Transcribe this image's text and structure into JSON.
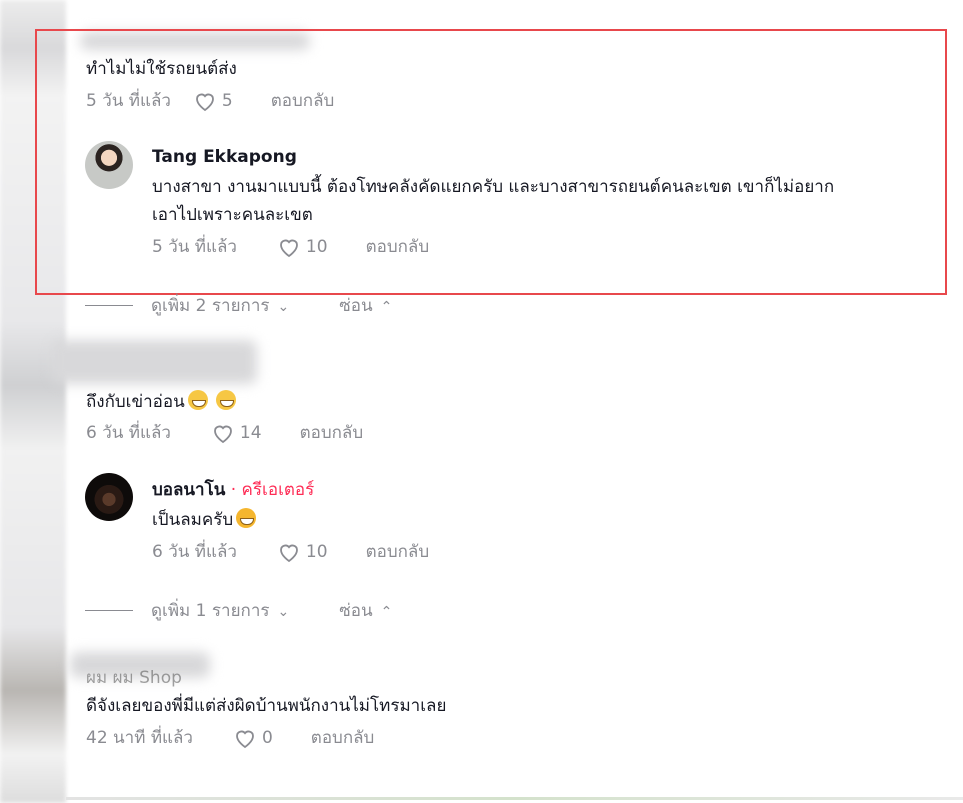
{
  "comments": [
    {
      "text": "ทำไมไม่ใช้รถยนต์ส่ง",
      "time": "5 วัน ที่แล้ว",
      "likes": "5",
      "reply": "ตอบกลับ"
    },
    {
      "username": "Tang Ekkapong",
      "text_line1": "บางสาขา งานมาแบบนี้ ต้องโทษคลังคัดแยกครับ และบางสาขารถยนต์คนละเขต เขาก็ไม่อยาก",
      "text_line2": "เอาไปเพราะคนละเขต",
      "time": "5 วัน ที่แล้ว",
      "likes": "10",
      "reply": "ตอบกลับ"
    },
    {
      "text": "ถึงกับเข่าอ่อน",
      "time": "6 วัน ที่แล้ว",
      "likes": "14",
      "reply": "ตอบกลับ"
    },
    {
      "username": "บอลนาโน",
      "creator_badge": "· ครีเอเตอร์",
      "text": "เป็นลมครับ",
      "time": "6 วัน ที่แล้ว",
      "likes": "10",
      "reply": "ตอบกลับ"
    },
    {
      "username_partial": "ผม ผม Shop",
      "text": "ดีจังเลยของพี่มีแต่ส่งผิดบ้านพนักงานไม่โทรมาเลย",
      "time": "42 นาที ที่แล้ว",
      "likes": "0",
      "reply": "ตอบกลับ"
    }
  ],
  "view_more": [
    {
      "label": "ดูเพิ่ม 2 รายการ",
      "hide": "ซ่อน"
    },
    {
      "label": "ดูเพิ่ม 1 รายการ",
      "hide": "ซ่อน"
    }
  ],
  "icons": {
    "like": "heart-outline-icon",
    "expand": "chevron-down-icon",
    "collapse": "chevron-up-icon"
  },
  "colors": {
    "highlight": "#e8484c",
    "creator": "#fe2c55",
    "muted": "#8a8b91"
  }
}
